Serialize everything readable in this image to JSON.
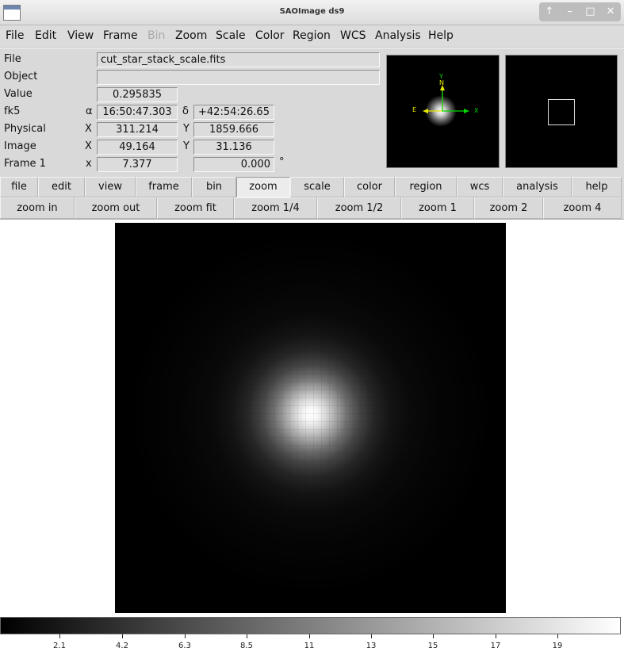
{
  "window": {
    "title": "SAOImage ds9",
    "controls": [
      "↑",
      "–",
      "□",
      "✕"
    ]
  },
  "menubar": {
    "items": [
      {
        "label": "File",
        "enabled": true
      },
      {
        "label": "Edit",
        "enabled": true
      },
      {
        "label": "View",
        "enabled": true
      },
      {
        "label": "Frame",
        "enabled": true
      },
      {
        "label": "Bin",
        "enabled": false
      },
      {
        "label": "Zoom",
        "enabled": true
      },
      {
        "label": "Scale",
        "enabled": true
      },
      {
        "label": "Color",
        "enabled": true
      },
      {
        "label": "Region",
        "enabled": true
      },
      {
        "label": "WCS",
        "enabled": true
      },
      {
        "label": "Analysis",
        "enabled": true
      },
      {
        "label": "Help",
        "enabled": true
      }
    ]
  },
  "info": {
    "file_label": "File",
    "file_value": "cut_star_stack_scale.fits",
    "object_label": "Object",
    "object_value": "",
    "value_label": "Value",
    "value_value": "0.295835",
    "wcs_label": "fk5",
    "wcs_alpha_sym": "α",
    "wcs_alpha": "16:50:47.303",
    "wcs_delta_sym": "δ",
    "wcs_delta": "+42:54:26.65",
    "physical_label": "Physical",
    "physical_x_sym": "X",
    "physical_x": "311.214",
    "physical_y_sym": "Y",
    "physical_y": "1859.666",
    "image_label": "Image",
    "image_x_sym": "X",
    "image_x": "49.164",
    "image_y_sym": "Y",
    "image_y": "31.136",
    "frame_label": "Frame 1",
    "frame_x_sym": "x",
    "frame_zoom": "7.377",
    "frame_angle": "0.000",
    "frame_angle_unit": "°"
  },
  "panner": {
    "compass_n": "N",
    "compass_e": "E",
    "axis_x": "X",
    "axis_y": "Y",
    "compass_color": "#e6e600"
  },
  "buttonbar": {
    "row1": [
      "file",
      "edit",
      "view",
      "frame",
      "bin",
      "zoom",
      "scale",
      "color",
      "region",
      "wcs",
      "analysis",
      "help"
    ],
    "row1_active": "zoom",
    "row2": [
      "zoom in",
      "zoom out",
      "zoom fit",
      "zoom 1/4",
      "zoom 1/2",
      "zoom 1",
      "zoom 2",
      "zoom 4"
    ]
  },
  "colorbar": {
    "gradient_start": "#000000",
    "gradient_end": "#ffffff",
    "labels": [
      "2.1",
      "4.2",
      "6.3",
      "8.5",
      "11",
      "13",
      "15",
      "17",
      "19"
    ]
  }
}
